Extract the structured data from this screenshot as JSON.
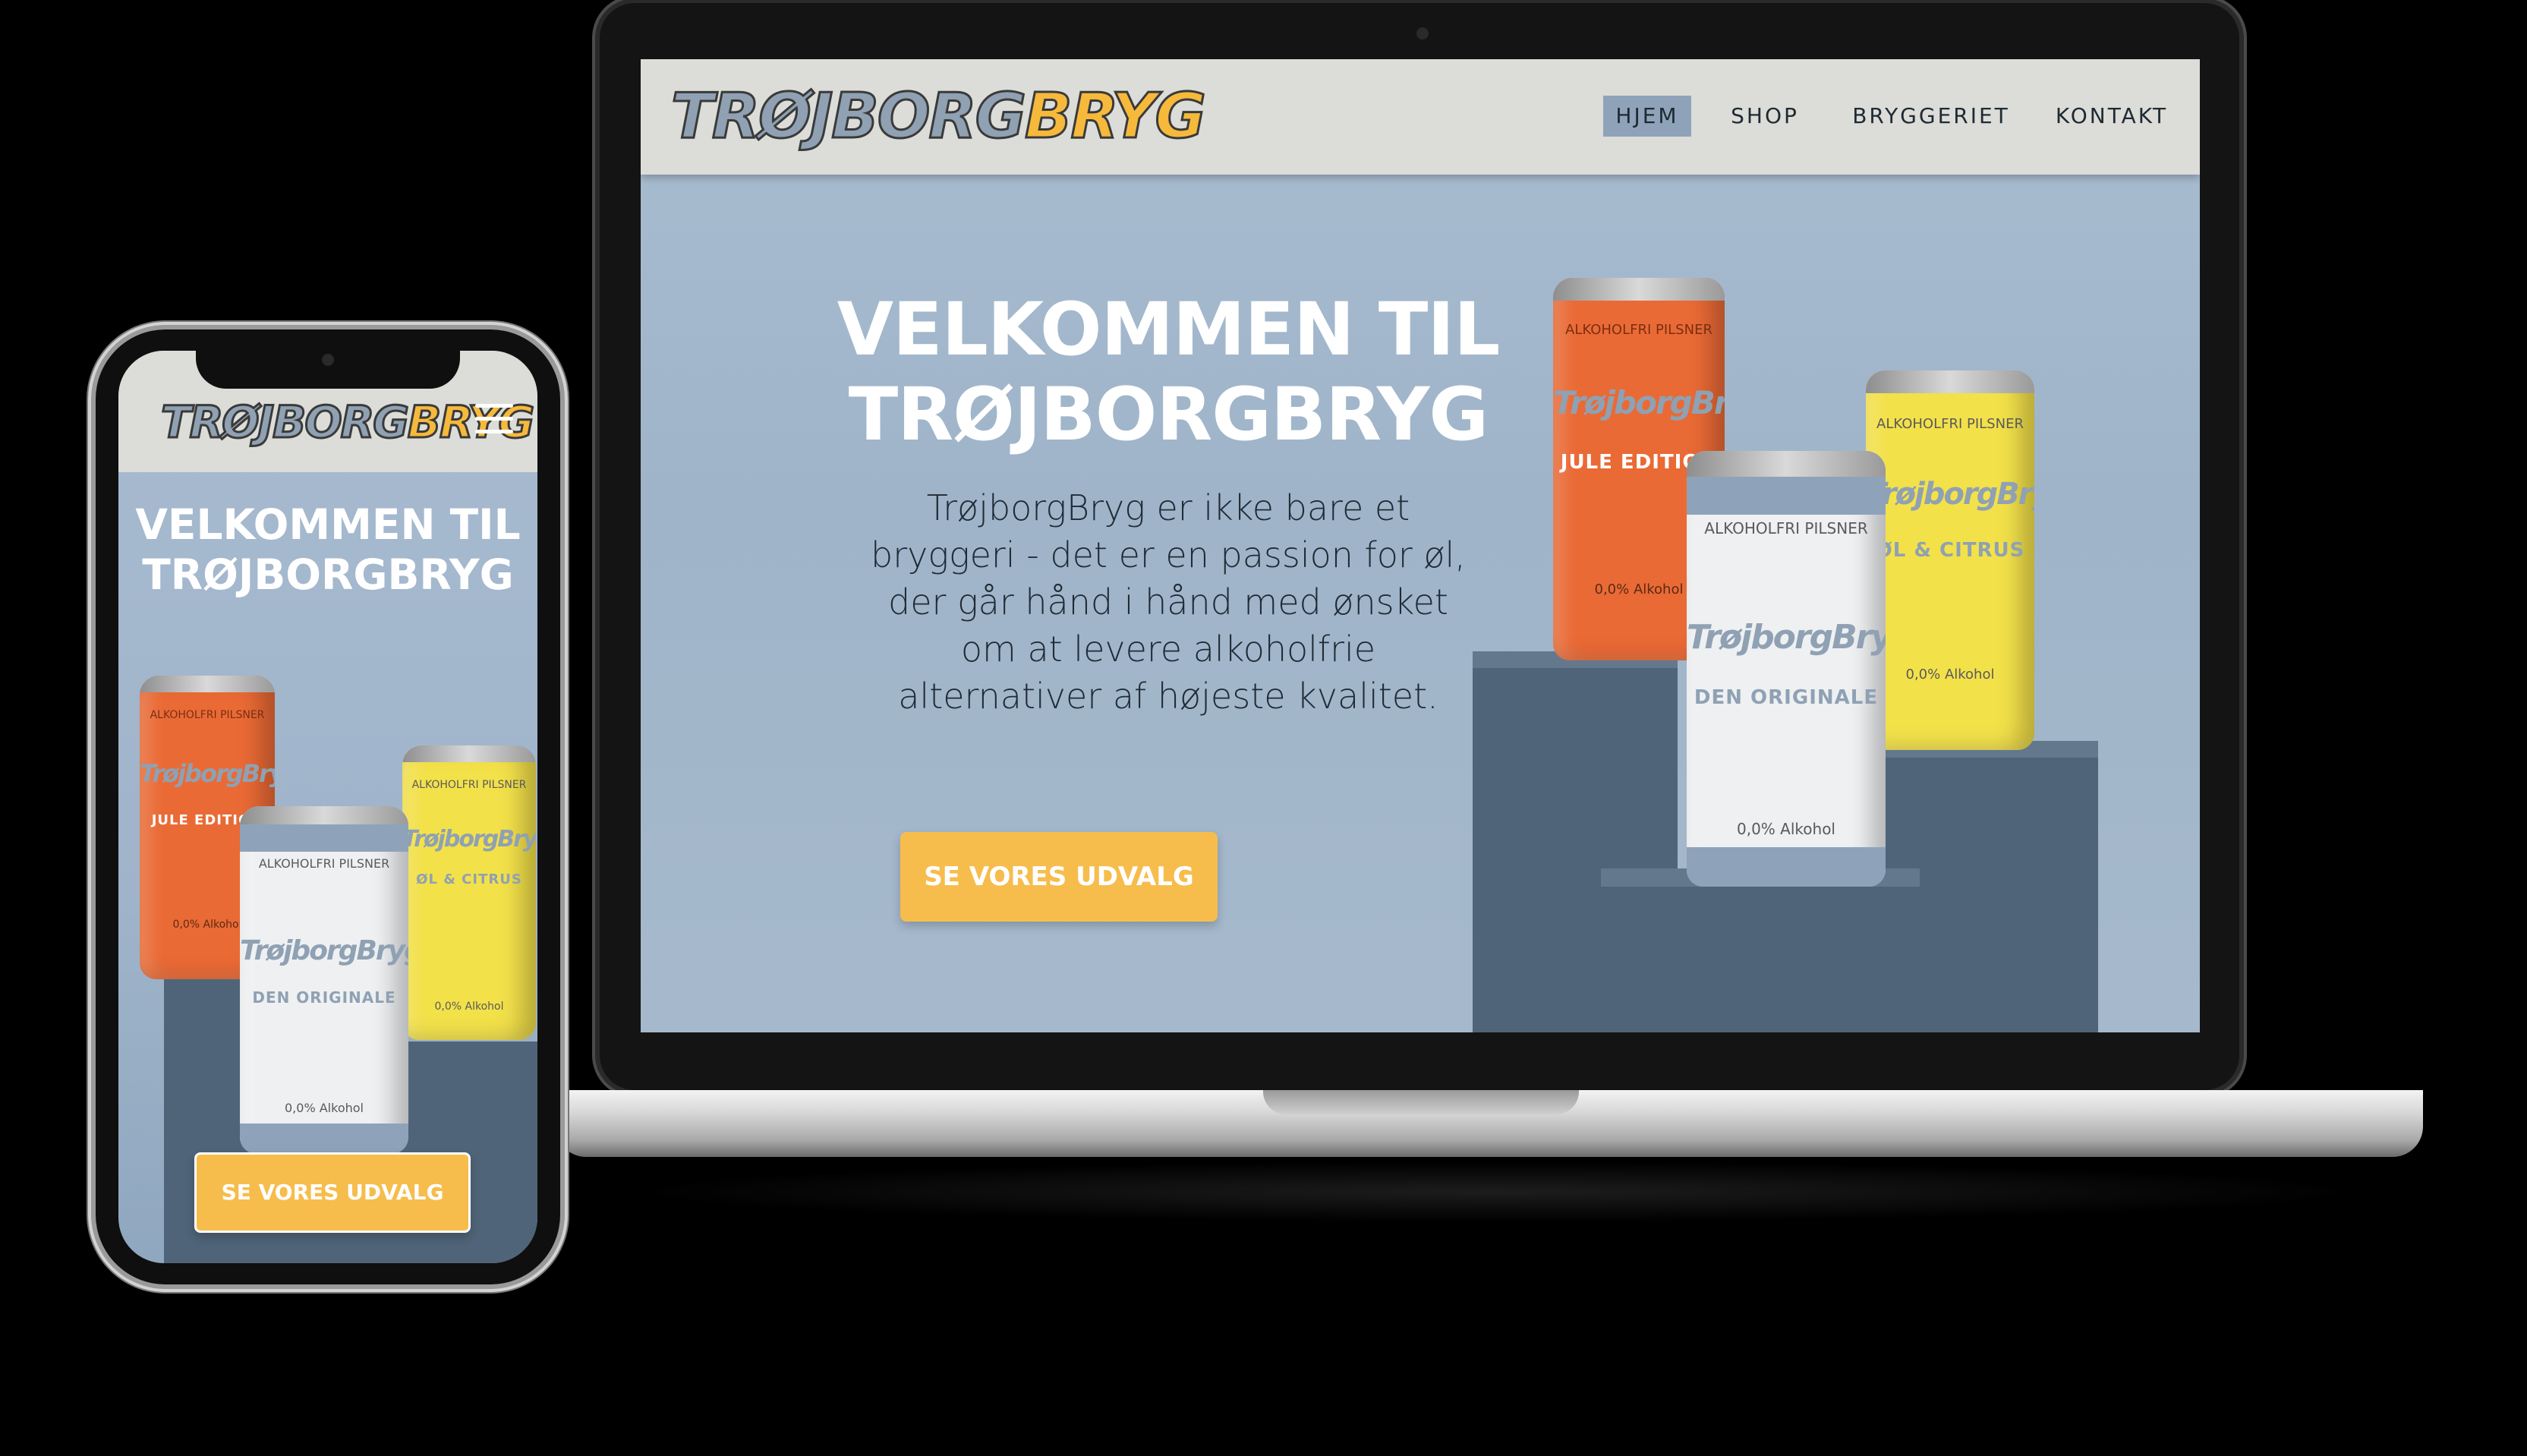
{
  "brand": {
    "part_a": "TRØJBORG",
    "part_b": "BRYG"
  },
  "nav": {
    "items": [
      {
        "label": "HJEM",
        "active": true
      },
      {
        "label": "SHOP",
        "active": false
      },
      {
        "label": "BRYGGERIET",
        "active": false
      },
      {
        "label": "KONTAKT",
        "active": false
      }
    ]
  },
  "hero": {
    "title_line1": "VELKOMMEN TIL",
    "title_line2": "TRØJBORGBRYG",
    "text_lines": [
      "TrøjborgBryg er ikke bare et",
      "bryggeri - det er en passion for øl,",
      "der går hånd i hånd med ønsket",
      "om at levere alkoholfrie",
      "alternativer af højeste kvalitet."
    ],
    "cta": "SE VORES UDVALG"
  },
  "cans": {
    "orange": {
      "top": "ALKOHOLFRI PILSNER",
      "brand": "TrøjborgBryg",
      "sub": "JULE EDITION",
      "alc": "0,0% Alkohol",
      "color": "#ea6a35"
    },
    "white": {
      "top": "ALKOHOLFRI PILSNER",
      "brand": "TrøjborgBryg",
      "sub": "DEN ORIGINALE",
      "alc": "0,0% Alkohol",
      "color": "#eef0f2"
    },
    "yellow": {
      "top": "ALKOHOLFRI PILSNER",
      "brand": "TrøjborgBryg",
      "sub": "ØL & CITRUS",
      "alc": "0,0% Alkohol",
      "color": "#f3e14a"
    }
  },
  "colors": {
    "header_bg": "#dcdcd8",
    "hero_bg": "#a5b9cd",
    "cta_bg": "#f6bd4d",
    "nav_active": "#8ea3b9"
  }
}
